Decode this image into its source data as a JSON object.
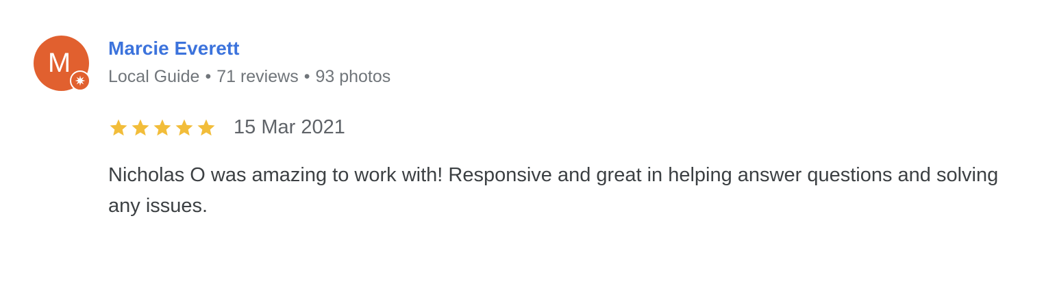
{
  "colors": {
    "avatar_bg": "#e1602f",
    "name": "#3c73dc",
    "star": "#f2bd3a",
    "meta": "#70757a",
    "text": "#3c4043"
  },
  "reviewer": {
    "avatar_letter": "M",
    "name": "Marcie Everett",
    "badge_icon": "local-guide-star-icon",
    "level": "Local Guide",
    "separator": "•",
    "reviews": "71 reviews",
    "photos": "93 photos"
  },
  "rating": {
    "stars": 5,
    "max": 5
  },
  "date": "15 Mar 2021",
  "review_text": "Nicholas O was amazing to work with! Responsive and great in helping answer questions and solving any issues."
}
